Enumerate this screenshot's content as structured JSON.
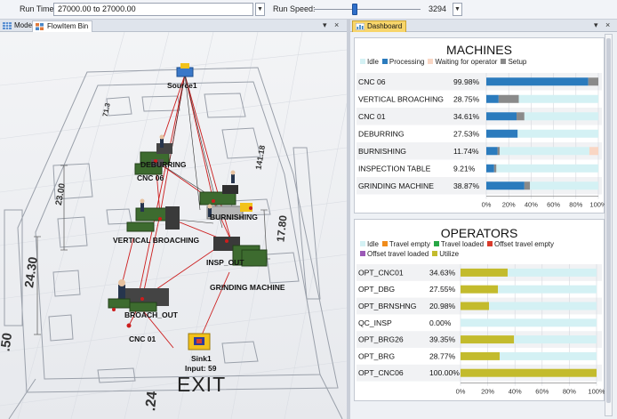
{
  "toolbar": {
    "run_time_label": "Run Time:",
    "run_time_value": "27000.00  to  27000.00",
    "run_speed_label": "Run Speed:",
    "run_speed_value": "3294",
    "run_speed_fraction": 0.38
  },
  "tabs": {
    "model_label": "Model",
    "flowitem_label": "FlowItem Bin",
    "dashboard_label": "Dashboard",
    "close_glyph": "×",
    "menu_glyph": "▾"
  },
  "model_view": {
    "labels": {
      "source": "Source1",
      "deburring": "DEBURRING",
      "cnc06": "CNC 06",
      "burnishing": "BURNISHING",
      "vertical": "VERTICAL BROACHING",
      "insp": "INSP_OUT",
      "grinding": "GRINDING MACHINE",
      "broach": "BROACH_OUT",
      "cnc01": "CNC 01",
      "sink": "Sink1",
      "sink_input": "Input: 59",
      "exit": "EXIT"
    },
    "dims": {
      "d1": "23.00",
      "d2": "24.30",
      "d3": "17.80",
      "d4": "141.18",
      "d5": ".24",
      "d6": "71.3",
      "d7": ".50"
    },
    "colors": {
      "floor_line": "#9aa0aa",
      "path_line": "#cc1d1d",
      "machine_green": "#3d6b2f",
      "sink_yellow": "#f5c518"
    }
  },
  "machines_panel": {
    "title": "MACHINES",
    "legend": [
      {
        "label": "Idle",
        "color": "#d4f1f4"
      },
      {
        "label": "Processing",
        "color": "#2b7bbd"
      },
      {
        "label": "Waiting for operator",
        "color": "#f9d6c4"
      },
      {
        "label": "Setup",
        "color": "#8a8a8a"
      }
    ],
    "x_ticks": [
      "0%",
      "20%",
      "40%",
      "60%",
      "80%",
      "100%"
    ],
    "rows": [
      {
        "name": "CNC 06",
        "pct": "99.98%",
        "segments": [
          {
            "state": "Processing",
            "value": 91
          },
          {
            "state": "Setup",
            "value": 9
          }
        ]
      },
      {
        "name": "VERTICAL BROACHING",
        "pct": "28.75%",
        "segments": [
          {
            "state": "Processing",
            "value": 11
          },
          {
            "state": "Setup",
            "value": 18
          },
          {
            "state": "Idle",
            "value": 71
          }
        ]
      },
      {
        "name": "CNC 01",
        "pct": "34.61%",
        "segments": [
          {
            "state": "Processing",
            "value": 27
          },
          {
            "state": "Setup",
            "value": 7
          },
          {
            "state": "Idle",
            "value": 66
          }
        ]
      },
      {
        "name": "DEBURRING",
        "pct": "27.53%",
        "segments": [
          {
            "state": "Processing",
            "value": 28
          },
          {
            "state": "Idle",
            "value": 72
          }
        ]
      },
      {
        "name": "BURNISHING",
        "pct": "11.74%",
        "segments": [
          {
            "state": "Processing",
            "value": 10
          },
          {
            "state": "Setup",
            "value": 2
          },
          {
            "state": "Idle",
            "value": 80
          },
          {
            "state": "Waiting for operator",
            "value": 8
          }
        ]
      },
      {
        "name": "INSPECTION TABLE",
        "pct": "9.21%",
        "segments": [
          {
            "state": "Processing",
            "value": 7
          },
          {
            "state": "Setup",
            "value": 2
          },
          {
            "state": "Idle",
            "value": 91
          }
        ]
      },
      {
        "name": "GRINDING MACHINE",
        "pct": "38.87%",
        "segments": [
          {
            "state": "Processing",
            "value": 34
          },
          {
            "state": "Setup",
            "value": 5
          },
          {
            "state": "Idle",
            "value": 61
          }
        ]
      }
    ]
  },
  "operators_panel": {
    "title": "OPERATORS",
    "legend": [
      {
        "label": "Idle",
        "color": "#d4f1f4"
      },
      {
        "label": "Travel empty",
        "color": "#f08c1c"
      },
      {
        "label": "Travel loaded",
        "color": "#28a745"
      },
      {
        "label": "Offset travel empty",
        "color": "#d93a2b"
      },
      {
        "label": "Offset travel loaded",
        "color": "#9b59b6"
      },
      {
        "label": "Utilize",
        "color": "#c3bb2d"
      }
    ],
    "x_ticks": [
      "0%",
      "20%",
      "40%",
      "60%",
      "80%",
      "100%"
    ],
    "rows": [
      {
        "name": "OPT_CNC01",
        "pct": "34.63%",
        "utilize": 34.63
      },
      {
        "name": "OPT_DBG",
        "pct": "27.55%",
        "utilize": 27.55
      },
      {
        "name": "OPT_BRNSHNG",
        "pct": "20.98%",
        "utilize": 20.98
      },
      {
        "name": "QC_INSP",
        "pct": "0.00%",
        "utilize": 0
      },
      {
        "name": "OPT_BRG26",
        "pct": "39.35%",
        "utilize": 39.35
      },
      {
        "name": "OPT_BRG",
        "pct": "28.77%",
        "utilize": 28.77
      },
      {
        "name": "OPT_CNC06",
        "pct": "100.00%",
        "utilize": 100
      }
    ]
  }
}
